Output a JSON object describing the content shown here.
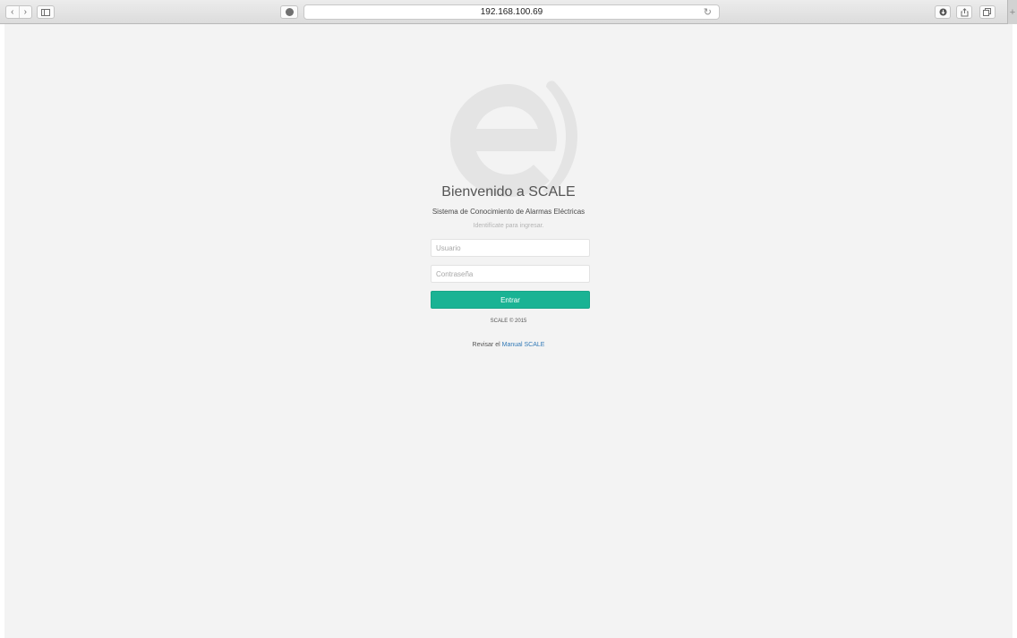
{
  "browser": {
    "url": "192.168.100.69",
    "icons": {
      "back": "chevron-left-icon",
      "forward": "chevron-right-icon",
      "sidebar": "sidebar-icon",
      "reload": "reload-icon",
      "downloads": "download-icon",
      "share": "share-icon",
      "tabs": "tabs-icon",
      "new_tab": "plus-icon"
    }
  },
  "login": {
    "logo": "e-logo",
    "title": "Bienvenido a SCALE",
    "subtitle": "Sistema de Conocimiento de Alarmas Eléctricas",
    "hint": "Identifícate para ingresar.",
    "username_placeholder": "Usuario",
    "password_placeholder": "Contraseña",
    "submit_label": "Entrar",
    "copyright": "SCALE © 2015",
    "manual_prefix": "Revisar el",
    "manual_link": "Manual SCALE"
  },
  "colors": {
    "accent": "#1ab394",
    "link": "#337ab7",
    "background": "#f3f3f3",
    "logo": "#e5e5e5"
  }
}
